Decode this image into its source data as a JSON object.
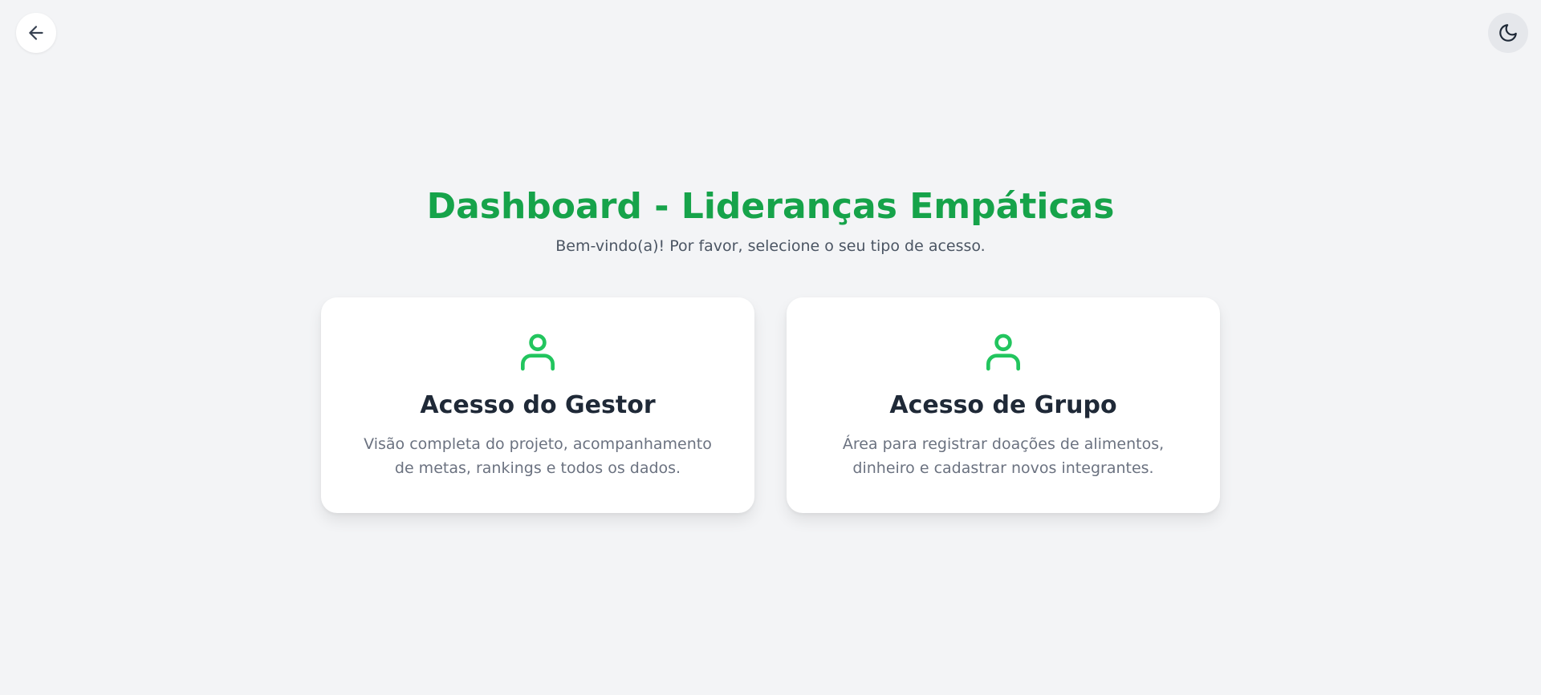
{
  "colors": {
    "accent": "#16a34a",
    "icon": "#22c55e",
    "background": "#f3f4f6",
    "card": "#ffffff",
    "title_text": "#1f2937",
    "muted_text": "#6b7280"
  },
  "topbar": {
    "back_icon": "arrow-left-icon",
    "theme_icon": "moon-icon"
  },
  "header": {
    "title": "Dashboard - Lideranças Empáticas",
    "subtitle": "Bem-vindo(a)! Por favor, selecione o seu tipo de acesso."
  },
  "cards": [
    {
      "icon": "user-icon",
      "title": "Acesso do Gestor",
      "description": "Visão completa do projeto, acompanhamento de metas, rankings e todos os dados."
    },
    {
      "icon": "user-icon",
      "title": "Acesso de Grupo",
      "description": "Área para registrar doações de alimentos, dinheiro e cadastrar novos integrantes."
    }
  ]
}
